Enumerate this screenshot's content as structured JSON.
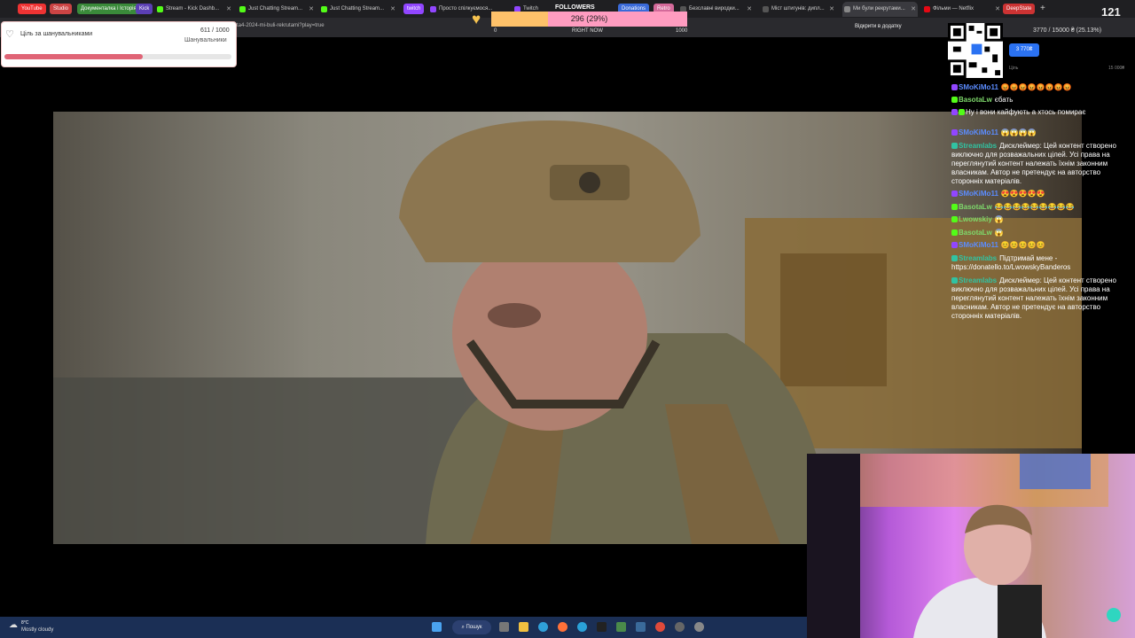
{
  "browser": {
    "bookmarks": [
      "YouTube",
      "Studio",
      "Документалка і Історія",
      "Kick",
      "twitch",
      "Donations",
      "Retro",
      "DeepState"
    ],
    "tabs": [
      {
        "label": "Stream - Kick Dashb...",
        "active": false
      },
      {
        "label": "Just Chatting Stream...",
        "active": false
      },
      {
        "label": "Just Chatting Stream...",
        "active": false
      },
      {
        "label": "Просто спілкуємося...",
        "active": false
      },
      {
        "label": "Twitch",
        "active": false
      },
      {
        "label": "Безславні виродки...",
        "active": false
      },
      {
        "label": "Міст штигунів: дипл...",
        "active": false
      },
      {
        "label": "Ми були рекрутами...",
        "active": true
      },
      {
        "label": "Фільми — Netflix",
        "active": false
      }
    ],
    "url": "...ta4-2024-mi-buli-rekrutami?play=true",
    "open_in_app": "Відкрити в додатку"
  },
  "follower_goal": {
    "title": "Ціль за шанувальниками",
    "current": "611",
    "target": "/ 1000",
    "subtitle": "Шанувальники",
    "progress": 0.611
  },
  "followers_widget": {
    "label": "FOLLOWERS",
    "value": "296 (29%)",
    "min": "0",
    "now": "RIGHT NOW",
    "max": "1000",
    "progress": 0.29
  },
  "donate": {
    "goal_text": "3770 / 15000 ₴ (25.13%)",
    "button": "3 770₴",
    "label": "Ціль",
    "max": "15 000₴"
  },
  "viewers": "121",
  "chat": [
    {
      "user": "SMoKiMo11",
      "color": "#5b8cff",
      "text": "😡😡😡😡😡😡😡😡"
    },
    {
      "user": "BasotaLw",
      "color": "#7ed96b",
      "text": "єбать"
    },
    {
      "user": "",
      "color": "#9b7be8",
      "text": "Ну і вони кайфують а хтось помирає"
    },
    {
      "user": "SMoKiMo11",
      "color": "#5b8cff",
      "text": "😱😱😱😱"
    },
    {
      "user": "Streamlabs",
      "color": "#31c3a2",
      "text": "Дисклеймер: Цей контент створено виключно для розважальних цілей. Усі права на переглянутий контент належать їхнім законним власникам. Автор не претендує на авторство сторонніх матеріалів."
    },
    {
      "user": "SMoKiMo11",
      "color": "#5b8cff",
      "text": "😍😍😍😍😍"
    },
    {
      "user": "BasotaLw",
      "color": "#7ed96b",
      "text": "😂😂😂😂😂😂😂😂😂"
    },
    {
      "user": "Lwowskiy",
      "color": "#7ed96b",
      "text": "😱"
    },
    {
      "user": "BasotaLw",
      "color": "#7ed96b",
      "text": "😱"
    },
    {
      "user": "SMoKiMo11",
      "color": "#5b8cff",
      "text": "😊😊😊😊😊"
    },
    {
      "user": "Streamlabs",
      "color": "#31c3a2",
      "text": "Підтримай мене - https://donatello.to/LwowskyBanderos"
    },
    {
      "user": "Streamlabs",
      "color": "#31c3a2",
      "text": "Дисклеймер: Цей контент створено виключно для розважальних цілей. Усі права на переглянутий контент належать їхнім законним власникам. Автор не претендує на авторство сторонніх матеріалів."
    }
  ],
  "taskbar": {
    "weather_temp": "8°C",
    "weather_desc": "Mostly cloudy",
    "search": "Пошук"
  },
  "colors": {
    "accent_pink": "#e06476",
    "taskbar": "#1b2f55",
    "donate_blue": "#2b72f2"
  }
}
